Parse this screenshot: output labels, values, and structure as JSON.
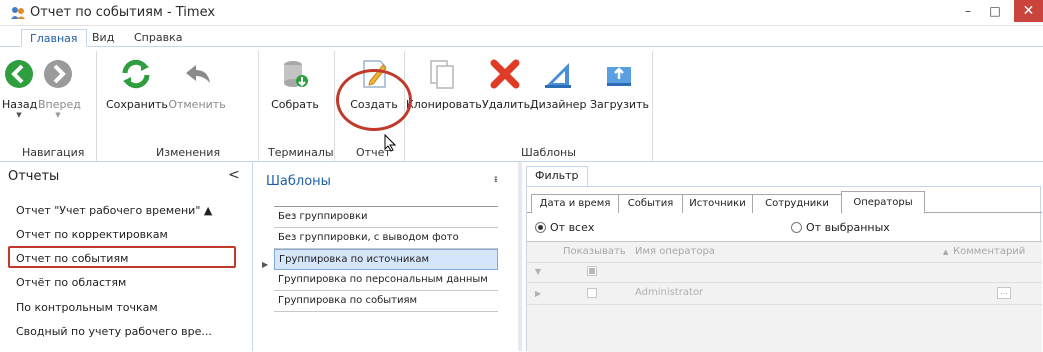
{
  "window": {
    "title": "Отчет по событиям - Timex",
    "minimize": "–",
    "maximize": "□",
    "close": "✕"
  },
  "tabs": [
    "Главная",
    "Вид",
    "Справка"
  ],
  "ribbon": {
    "buttons": [
      {
        "label": "Назад",
        "enabled": true
      },
      {
        "label": "Вперед",
        "enabled": false
      },
      {
        "label": "Сохранить",
        "enabled": true
      },
      {
        "label": "Отменить",
        "enabled": false
      },
      {
        "label": "Собрать",
        "enabled": true
      },
      {
        "label": "Создать",
        "enabled": true
      },
      {
        "label": "Клонировать",
        "enabled": true
      },
      {
        "label": "Удалить",
        "enabled": true
      },
      {
        "label": "Дизайнер",
        "enabled": true
      },
      {
        "label": "Загрузить",
        "enabled": true
      }
    ],
    "groups": [
      "Навигация",
      "Изменения",
      "Терминалы",
      "Отчет",
      "Шаблоны"
    ],
    "highlight_color": "#c0392b"
  },
  "sidebar": {
    "title": "Отчеты",
    "collapse": "<",
    "items": [
      "Отчет \"Учет рабочего времени\"  ▲",
      "Отчет по корректировкам",
      "Отчет по событиям",
      "Отчёт по областям",
      "По контрольным точкам",
      "Сводный по учету рабочего вре..."
    ],
    "selected_index": 2
  },
  "templates": {
    "title": "Шаблоны",
    "pin": "ᵻ",
    "items": [
      "Без группировки",
      "Без группировки, с выводом фото",
      "Группировка по источникам",
      "Группировка по персональным данным",
      "Группировка по событиям"
    ],
    "selected_index": 2
  },
  "filter": {
    "tab": "Фильтр",
    "subtabs": [
      "Дата и время",
      "События",
      "Источники",
      "Сотрудники",
      "Операторы"
    ],
    "active_subtab": 4,
    "radio_all": "От всех",
    "radio_selected": "От выбранных",
    "grid": {
      "headers": [
        "Показывать",
        "Имя оператора",
        "Комментарий"
      ],
      "sort_indicator": "▲",
      "rows": [
        {
          "name": "Administrator",
          "comment_button": "..."
        }
      ]
    }
  }
}
